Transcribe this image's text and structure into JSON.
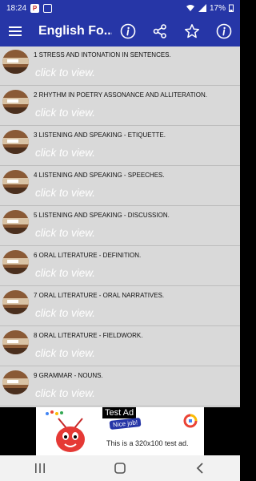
{
  "status": {
    "time": "18:24",
    "battery": "17%"
  },
  "app_bar": {
    "title": "English Fo...",
    "menu_icon": "hamburger-icon",
    "actions": [
      "info-icon",
      "share-icon",
      "star-icon",
      "info-icon"
    ]
  },
  "list": {
    "items": [
      {
        "title": "1 STRESS AND INTONATION IN SENTENCES.",
        "subtitle": "click to view."
      },
      {
        "title": "2 RHYTHM IN POETRY ASSONANCE AND ALLITERATION.",
        "subtitle": "click to view."
      },
      {
        "title": "3 LISTENING AND SPEAKING - ETIQUETTE.",
        "subtitle": "click to view."
      },
      {
        "title": "4 LISTENING AND SPEAKING - SPEECHES.",
        "subtitle": "click to view."
      },
      {
        "title": "5 LISTENING AND SPEAKING - DISCUSSION.",
        "subtitle": "click to view."
      },
      {
        "title": "6 ORAL LITERATURE - DEFINITION.",
        "subtitle": "click to view."
      },
      {
        "title": "7 ORAL LITERATURE - ORAL NARRATIVES.",
        "subtitle": "click to view."
      },
      {
        "title": "8 ORAL LITERATURE - FIELDWORK.",
        "subtitle": "click to view."
      },
      {
        "title": "9 GRAMMAR - NOUNS.",
        "subtitle": "click to view."
      }
    ]
  },
  "ad": {
    "badge": "Test Ad",
    "bubble": "Nice job!",
    "text": "This is a 320x100 test ad."
  },
  "colors": {
    "primary": "#2636a7",
    "list_bg": "#d9d9d9"
  }
}
